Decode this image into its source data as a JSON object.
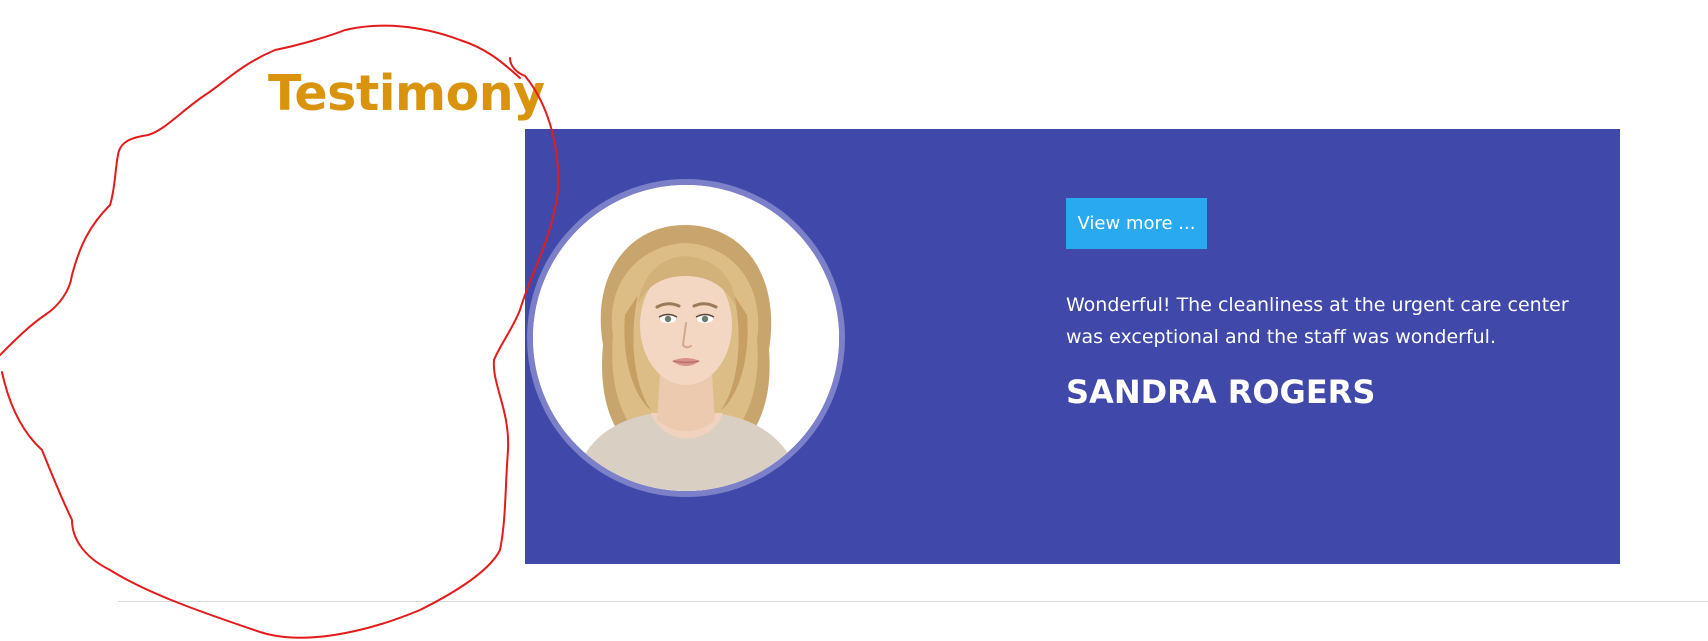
{
  "section": {
    "title": "Testimony"
  },
  "testimonial": {
    "button_label": "View more ...",
    "quote": "Wonderful! The cleanliness at the urgent care center was exceptional and the staff was wonderful.",
    "name": "SANDRA ROGERS"
  },
  "colors": {
    "title": "#d9930d",
    "card_background": "#4048a9",
    "button_background": "#29a9ef",
    "annotation_stroke": "#e31b1b"
  }
}
